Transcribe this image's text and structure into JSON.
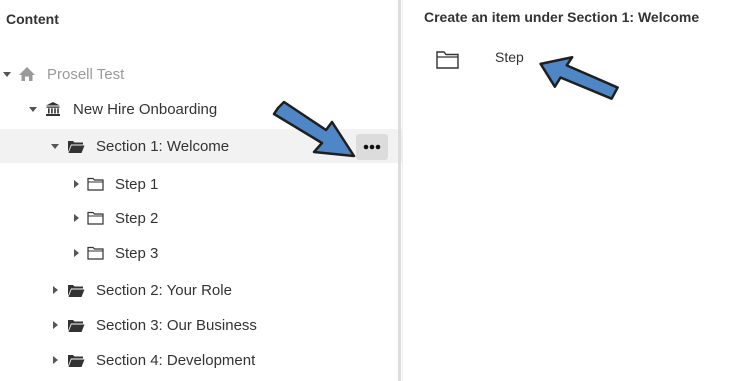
{
  "left_panel": {
    "title": "Content",
    "tree": [
      {
        "label": "Prosell Test",
        "icon": "home-icon",
        "state": "expanded",
        "muted": true
      },
      {
        "label": "New Hire Onboarding",
        "icon": "institution-icon",
        "state": "expanded"
      },
      {
        "label": "Section 1: Welcome",
        "icon": "folder-open-icon",
        "state": "expanded",
        "selected": true
      },
      {
        "label": "Step 1",
        "icon": "folder-outline-icon",
        "state": "collapsed"
      },
      {
        "label": "Step 2",
        "icon": "folder-outline-icon",
        "state": "collapsed"
      },
      {
        "label": "Step 3",
        "icon": "folder-outline-icon",
        "state": "collapsed"
      },
      {
        "label": "Section 2: Your Role",
        "icon": "folder-open-icon",
        "state": "collapsed"
      },
      {
        "label": "Section 3: Our Business",
        "icon": "folder-open-icon",
        "state": "collapsed"
      },
      {
        "label": "Section 4: Development",
        "icon": "folder-open-icon",
        "state": "collapsed"
      }
    ],
    "more_button_icon": "ellipsis-icon"
  },
  "right_panel": {
    "title": "Create an item under Section 1: Welcome",
    "option_label": "Step",
    "option_icon": "folder-outline-icon"
  },
  "colors": {
    "callout_arrow_fill": "#4f86c6",
    "callout_arrow_stroke": "#1f1f1f",
    "selected_row_bg": "#f2f2f2",
    "more_button_bg": "#dcdcdc",
    "muted_text": "#9a9a9a"
  }
}
